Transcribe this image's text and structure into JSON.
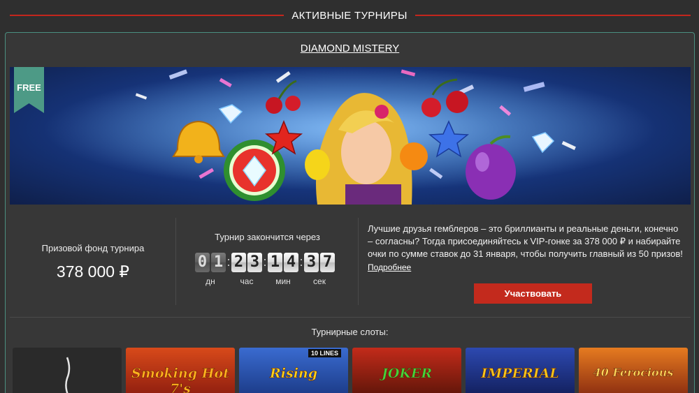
{
  "section": {
    "title": "АКТИВНЫЕ ТУРНИРЫ"
  },
  "tournament": {
    "title": "DIAMOND MISTERY",
    "badge": "FREE",
    "prize_label": "Призовой фонд турнира",
    "prize_value": "378 000 ₽",
    "ends_label": "Турнир закончится через",
    "timer": {
      "days": [
        "0",
        "1"
      ],
      "hours": [
        "2",
        "3"
      ],
      "minutes": [
        "1",
        "4"
      ],
      "seconds": [
        "3",
        "7"
      ],
      "units": {
        "days": "дн",
        "hours": "час",
        "minutes": "мин",
        "seconds": "сек"
      }
    },
    "description": "Лучшие друзья гемблеров – это бриллианты и реальные деньги, конечно – согласны? Тогда присоединяйтесь к VIP-гонке за 378 000 ₽ и набирайте очки по сумме ставок до 31 января, чтобы получить главный из 50 призов!",
    "more_link": "Подробнее",
    "join_button": "Участвовать"
  },
  "slots": {
    "label": "Турнирные слоты:",
    "items": [
      {
        "name": "",
        "color": "#2a2a2a"
      },
      {
        "name": "Smoking Hot 7's",
        "color": "#b3301c"
      },
      {
        "name": "Rising",
        "color": "#2a4f9a",
        "extra": "10 LINES"
      },
      {
        "name": "JOKER",
        "color": "#3b7d2a"
      },
      {
        "name": "IMPERIAL",
        "color": "#243a8f"
      },
      {
        "name": "40 Ferocious",
        "color": "#c2581f"
      }
    ]
  },
  "colors": {
    "accent": "#c4261d",
    "card_border": "#4a8f80",
    "button": "#c32a1d",
    "ribbon": "#4d9a86"
  }
}
